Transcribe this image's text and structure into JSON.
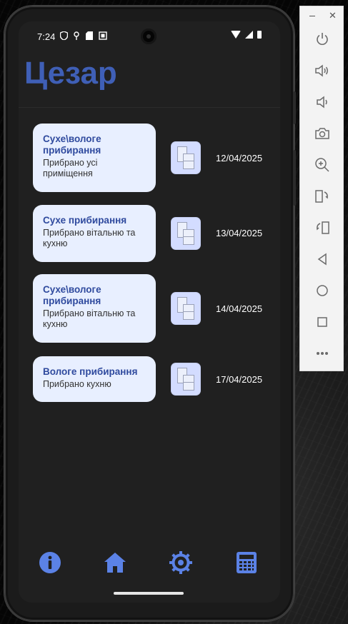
{
  "status": {
    "time": "7:24"
  },
  "app": {
    "title": "Цезар"
  },
  "records": [
    {
      "title": "Сухе\\вологе прибирання",
      "desc": "Прибрано усі приміщення",
      "date": "12/04/2025"
    },
    {
      "title": "Сухе прибирання",
      "desc": "Прибрано вітальню та кухню",
      "date": "13/04/2025"
    },
    {
      "title": "Сухе\\вологе прибирання",
      "desc": "Прибрано вітальню та кухню",
      "date": "14/04/2025"
    },
    {
      "title": "Вологе прибирання",
      "desc": "Прибрано кухню",
      "date": "17/04/2025"
    }
  ],
  "nav": [
    "info-icon",
    "home-icon",
    "settings-gear-icon",
    "calculator-icon"
  ],
  "colors": {
    "accent": "#3f5fb6",
    "card_bg": "#e8efff",
    "nav_icon": "#5b82e6",
    "screen_bg": "#202020"
  },
  "toolbar": [
    "power-icon",
    "volume-up-icon",
    "volume-down-icon",
    "camera-icon",
    "zoom-icon",
    "rotate-left-icon",
    "rotate-right-icon",
    "back-icon",
    "home-circle-icon",
    "overview-icon",
    "more-icon"
  ]
}
